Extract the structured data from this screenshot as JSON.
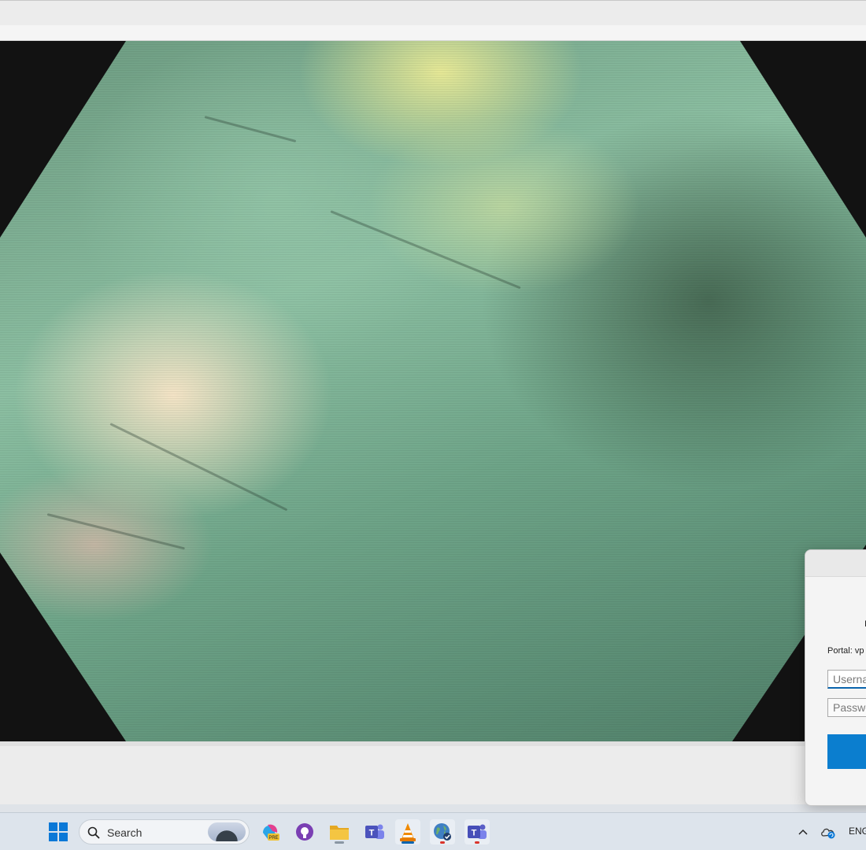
{
  "dialog": {
    "portal_label": "Portal: vp",
    "username_placeholder": "Userna",
    "password_placeholder": "Passwo",
    "partial_char": "I"
  },
  "taskbar": {
    "search_label": "Search",
    "language": "ENG",
    "apps": [
      "copilot-pre",
      "github-desktop",
      "file-explorer",
      "teams-classic",
      "vlc",
      "vpn-globe",
      "teams"
    ]
  },
  "colors": {
    "accent": "#0b7ecf",
    "taskbar": "#dde4ec",
    "video_bg": "#121212"
  }
}
